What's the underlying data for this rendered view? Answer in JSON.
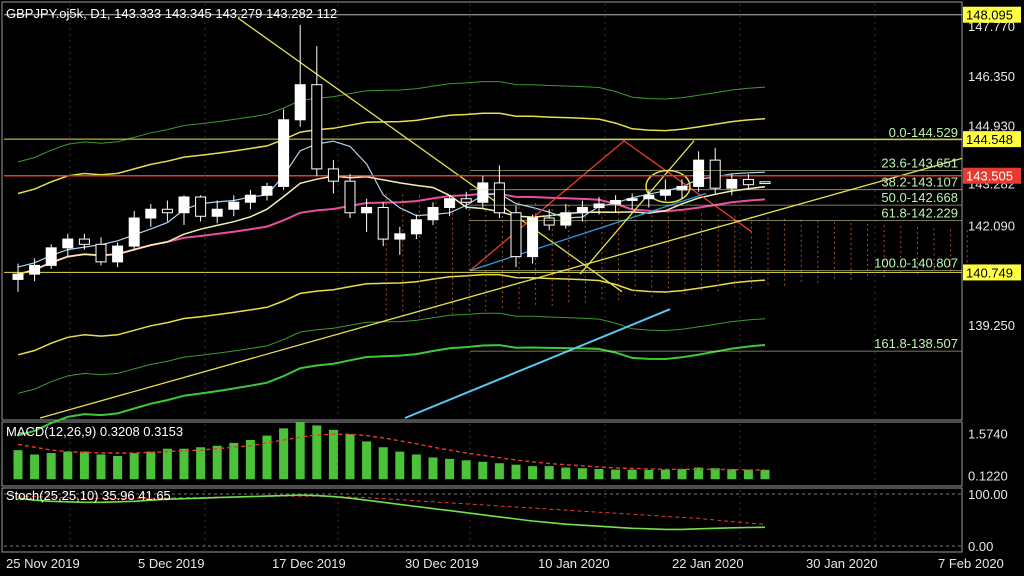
{
  "header": {
    "text": "GBPJPY.oj5k, D1, 143.333 143.345 143.279 143.282 112"
  },
  "colors": {
    "background": "#000000",
    "grid": "#333333",
    "bull_candle": "#ffffff",
    "bear_candle": "#000000",
    "fib_line": "#e8e8a0",
    "fib_text": "#b9f5b0",
    "red_line": "#e8392f",
    "blue_line": "#2e9bd6",
    "macd_bar": "#4cc23a",
    "signal_line": "#e8392f",
    "stoch_main": "#6ee24a",
    "stoch_signal": "#e8392f",
    "price_tag_yellow": "#ffff44",
    "price_tag_red": "#e8392f"
  },
  "price_axis": {
    "ticks": [
      "147.770",
      "146.350",
      "144.930",
      "143.282",
      "142.090",
      "139.250"
    ],
    "tags": [
      {
        "label": "148.095",
        "kind": "yellow"
      },
      {
        "label": "144.548",
        "kind": "yellow"
      },
      {
        "label": "143.505",
        "kind": "red"
      },
      {
        "label": "140.749",
        "kind": "yellow"
      }
    ]
  },
  "macd_panel": {
    "title": "MACD(12,26,9) 0.3208 0.3153",
    "ticks": [
      "1.5740",
      "0.1220"
    ]
  },
  "stoch_panel": {
    "title": "Stoch(25,25,10) 35.96 41.65",
    "ticks": [
      "100.00",
      "0.00"
    ]
  },
  "time_axis": {
    "labels": [
      "25 Nov 2019",
      "5 Dec 2019",
      "17 Dec 2019",
      "30 Dec 2019",
      "10 Jan 2020",
      "22 Jan 2020",
      "30 Jan 2020",
      "7 Feb 2020"
    ]
  },
  "fibonacci": [
    {
      "label": "0.0-144.529",
      "price": 144.529
    },
    {
      "label": "23.6-143.651",
      "price": 143.651
    },
    {
      "label": "38.2-143.107",
      "price": 143.107
    },
    {
      "label": "50.0-142.668",
      "price": 142.668
    },
    {
      "label": "61.8-142.229",
      "price": 142.229
    },
    {
      "label": "100.0-140.807",
      "price": 140.807
    },
    {
      "label": "161.8-138.507",
      "price": 138.507
    }
  ],
  "chart_data": {
    "type": "candlestick",
    "symbol": "GBPJPY.oj5k",
    "timeframe": "D1",
    "ylim": [
      136.6,
      148.4
    ],
    "candles": [
      {
        "o": 140.55,
        "h": 141.0,
        "l": 140.2,
        "c": 140.7
      },
      {
        "o": 140.7,
        "h": 141.15,
        "l": 140.5,
        "c": 140.95
      },
      {
        "o": 140.95,
        "h": 141.55,
        "l": 140.85,
        "c": 141.45
      },
      {
        "o": 141.45,
        "h": 141.85,
        "l": 141.2,
        "c": 141.7
      },
      {
        "o": 141.7,
        "h": 141.85,
        "l": 141.4,
        "c": 141.55
      },
      {
        "o": 141.55,
        "h": 141.75,
        "l": 140.95,
        "c": 141.05
      },
      {
        "o": 141.05,
        "h": 141.6,
        "l": 140.9,
        "c": 141.5
      },
      {
        "o": 141.5,
        "h": 142.5,
        "l": 141.4,
        "c": 142.3
      },
      {
        "o": 142.3,
        "h": 142.7,
        "l": 142.05,
        "c": 142.55
      },
      {
        "o": 142.55,
        "h": 142.8,
        "l": 142.2,
        "c": 142.45
      },
      {
        "o": 142.45,
        "h": 142.95,
        "l": 142.1,
        "c": 142.9
      },
      {
        "o": 142.9,
        "h": 142.95,
        "l": 142.2,
        "c": 142.35
      },
      {
        "o": 142.35,
        "h": 142.8,
        "l": 142.15,
        "c": 142.55
      },
      {
        "o": 142.55,
        "h": 142.95,
        "l": 142.35,
        "c": 142.75
      },
      {
        "o": 142.75,
        "h": 143.1,
        "l": 142.55,
        "c": 142.95
      },
      {
        "o": 142.95,
        "h": 143.3,
        "l": 142.8,
        "c": 143.2
      },
      {
        "o": 143.2,
        "h": 145.4,
        "l": 143.1,
        "c": 145.1
      },
      {
        "o": 145.1,
        "h": 147.8,
        "l": 144.9,
        "c": 146.1
      },
      {
        "o": 146.1,
        "h": 147.2,
        "l": 143.5,
        "c": 143.7
      },
      {
        "o": 143.7,
        "h": 143.95,
        "l": 143.0,
        "c": 143.35
      },
      {
        "o": 143.35,
        "h": 143.55,
        "l": 142.3,
        "c": 142.45
      },
      {
        "o": 142.45,
        "h": 142.85,
        "l": 141.9,
        "c": 142.6
      },
      {
        "o": 142.6,
        "h": 142.75,
        "l": 141.5,
        "c": 141.7
      },
      {
        "o": 141.7,
        "h": 142.05,
        "l": 141.25,
        "c": 141.85
      },
      {
        "o": 141.85,
        "h": 142.4,
        "l": 141.7,
        "c": 142.25
      },
      {
        "o": 142.25,
        "h": 142.75,
        "l": 142.1,
        "c": 142.6
      },
      {
        "o": 142.6,
        "h": 142.95,
        "l": 142.35,
        "c": 142.85
      },
      {
        "o": 142.85,
        "h": 143.05,
        "l": 142.55,
        "c": 142.75
      },
      {
        "o": 142.75,
        "h": 143.5,
        "l": 142.6,
        "c": 143.3
      },
      {
        "o": 143.3,
        "h": 143.8,
        "l": 142.3,
        "c": 142.45
      },
      {
        "o": 142.45,
        "h": 142.65,
        "l": 140.9,
        "c": 141.2
      },
      {
        "o": 141.2,
        "h": 142.4,
        "l": 141.0,
        "c": 142.3
      },
      {
        "o": 142.3,
        "h": 142.55,
        "l": 141.95,
        "c": 142.1
      },
      {
        "o": 142.1,
        "h": 142.7,
        "l": 142.0,
        "c": 142.45
      },
      {
        "o": 142.45,
        "h": 142.8,
        "l": 142.2,
        "c": 142.6
      },
      {
        "o": 142.6,
        "h": 142.9,
        "l": 142.4,
        "c": 142.7
      },
      {
        "o": 142.7,
        "h": 142.95,
        "l": 142.45,
        "c": 142.8
      },
      {
        "o": 142.8,
        "h": 143.0,
        "l": 142.55,
        "c": 142.85
      },
      {
        "o": 142.85,
        "h": 143.1,
        "l": 142.6,
        "c": 142.95
      },
      {
        "o": 142.95,
        "h": 143.4,
        "l": 142.8,
        "c": 143.1
      },
      {
        "o": 143.1,
        "h": 143.4,
        "l": 142.85,
        "c": 143.2
      },
      {
        "o": 143.2,
        "h": 144.2,
        "l": 143.05,
        "c": 143.95
      },
      {
        "o": 143.95,
        "h": 144.3,
        "l": 143.0,
        "c": 143.15
      },
      {
        "o": 143.15,
        "h": 143.55,
        "l": 142.95,
        "c": 143.4
      },
      {
        "o": 143.4,
        "h": 143.55,
        "l": 143.1,
        "c": 143.25
      },
      {
        "o": 143.333,
        "h": 143.345,
        "l": 143.279,
        "c": 143.282
      }
    ],
    "macd": {
      "title": "MACD(12,26,9)",
      "main": 0.3208,
      "signal": 0.3153,
      "ylim": [
        -0.2,
        1.9
      ],
      "bars": [
        1.0,
        0.85,
        0.9,
        0.95,
        0.95,
        0.85,
        0.8,
        0.9,
        0.95,
        1.05,
        1.05,
        1.1,
        1.15,
        1.25,
        1.35,
        1.5,
        1.75,
        1.95,
        1.85,
        1.7,
        1.55,
        1.3,
        1.1,
        0.95,
        0.85,
        0.75,
        0.7,
        0.65,
        0.6,
        0.55,
        0.5,
        0.45,
        0.45,
        0.4,
        0.38,
        0.35,
        0.33,
        0.33,
        0.32,
        0.33,
        0.35,
        0.4,
        0.38,
        0.35,
        0.33,
        0.32
      ],
      "signal_line": [
        1.2,
        1.1,
        1.0,
        0.95,
        0.92,
        0.9,
        0.9,
        0.9,
        0.92,
        0.95,
        0.98,
        1.0,
        1.05,
        1.1,
        1.15,
        1.25,
        1.35,
        1.45,
        1.52,
        1.55,
        1.55,
        1.5,
        1.42,
        1.32,
        1.22,
        1.1,
        1.0,
        0.9,
        0.82,
        0.74,
        0.66,
        0.6,
        0.54,
        0.5,
        0.46,
        0.42,
        0.39,
        0.37,
        0.35,
        0.34,
        0.34,
        0.34,
        0.34,
        0.33,
        0.32,
        0.3153
      ]
    },
    "stochastic": {
      "title": "Stoch(25,25,10)",
      "main_value": 35.96,
      "signal_value": 41.65,
      "ylim": [
        0,
        100
      ],
      "main": [
        92,
        88,
        86,
        85,
        84,
        84,
        85,
        86,
        88,
        90,
        91,
        92,
        93,
        94,
        95,
        96,
        97,
        98,
        97,
        95,
        92,
        88,
        84,
        80,
        76,
        72,
        68,
        64,
        60,
        56,
        52,
        48,
        45,
        42,
        40,
        38,
        36,
        34,
        33,
        32,
        32,
        33,
        34,
        35,
        35.5,
        35.96
      ],
      "signal": [
        96,
        95,
        94,
        93,
        92,
        92,
        91,
        91,
        92,
        92,
        93,
        93,
        94,
        94,
        95,
        95,
        96,
        96,
        96,
        95,
        94,
        93,
        91,
        89,
        87,
        85,
        83,
        81,
        79,
        77,
        75,
        73,
        71,
        69,
        67,
        65,
        63,
        61,
        59,
        57,
        55,
        53,
        50,
        47,
        44,
        41.65
      ]
    }
  }
}
